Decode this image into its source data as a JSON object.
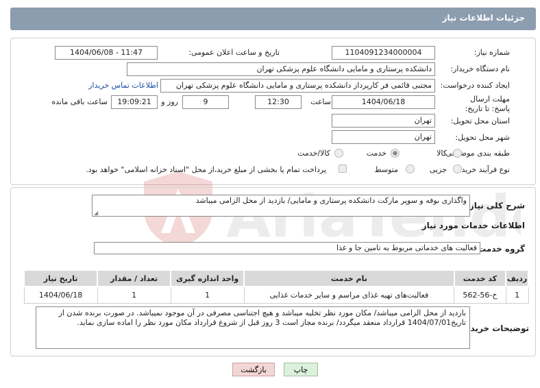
{
  "header": {
    "title": "جزئیات اطلاعات نیاز"
  },
  "form": {
    "need_number_label": "شماره نیاز:",
    "need_number": "1104091234000004",
    "announce_label": "تاریخ و ساعت اعلان عمومی:",
    "announce_value": "1404/06/08 - 11:47",
    "buyer_org_label": "نام دستگاه خریدار:",
    "buyer_org": "دانشکده پرستاری و مامایی دانشگاه علوم پزشکی تهران",
    "creator_label": "ایجاد کننده درخواست:",
    "creator": "مجتبی قائمی فر کارپرداز دانشکده پرستاری و مامایی دانشگاه علوم پزشکی تهران",
    "contact_link": "اطلاعات تماس خریدار",
    "deadline_label": "مهلت ارسال پاسخ: تا تاریخ:",
    "deadline_date": "1404/06/18",
    "time_label": "ساعت",
    "deadline_time": "12:30",
    "days_value": "9",
    "days_label": "روز و",
    "remaining_time": "19:09:21",
    "remaining_label": "ساعت باقی مانده",
    "province_label": "استان محل تحویل:",
    "province": "تهران",
    "city_label": "شهر محل تحویل:",
    "city": "تهران",
    "category_label": "طبقه بندی موضوعی:",
    "category_options": [
      "کالا",
      "خدمت",
      "کالا/خدمت"
    ],
    "category_selected": "خدمت",
    "process_label": "نوع فرآیند خرید :",
    "process_options": [
      "جزیی",
      "متوسط"
    ],
    "payment_note": "پرداخت تمام یا بخشی از مبلغ خرید،از محل \"اسناد خزانه اسلامی\" خواهد بود."
  },
  "summary": {
    "label": "شرح کلی نیاز:",
    "text": "واگذاری بوفه و سوپر مارکت دانشکده پرستاری و مامایی/ بازدید از محل الزامی میباشد"
  },
  "services": {
    "section_title": "اطلاعات خدمات مورد نیاز",
    "group_label": "گروه خدمت:",
    "group_value": "فعالیت های خدماتی مربوط به تامین جا و غذا",
    "columns": [
      "ردیف",
      "کد خدمت",
      "نام خدمت",
      "واحد اندازه گیری",
      "تعداد / مقدار",
      "تاریخ نیاز"
    ],
    "rows": [
      [
        "1",
        "خ-56-562",
        "فعالیت‌های تهیه غذای مراسم و سایر خدمات غذایی",
        "1",
        "1",
        "1404/06/18"
      ]
    ]
  },
  "buyer_notes": {
    "label": "توضیحات خریدار:",
    "text": "بازدید از محل الزامی میباشد/ مکان مورد نظر تخلیه  میباشد و هیچ اجتناسی مصرفی در آن موجود نمیباشد. در صورت برنده شدن از تاریخ1404/07/01 قرارداد منعقد میگردد/ برنده مجاز است 3 روز قبل از شروع قرارداد مکان  مورد نظر را اماده سازی نماید."
  },
  "buttons": {
    "print": "چاپ",
    "back": "بازگشت"
  },
  "watermark": "AriaTender.neT",
  "colors": {
    "header_bg": "#8d9db0",
    "back_button": "#f3d6d6",
    "print_button": "#dcf0dc",
    "link": "#1a4fa0"
  }
}
